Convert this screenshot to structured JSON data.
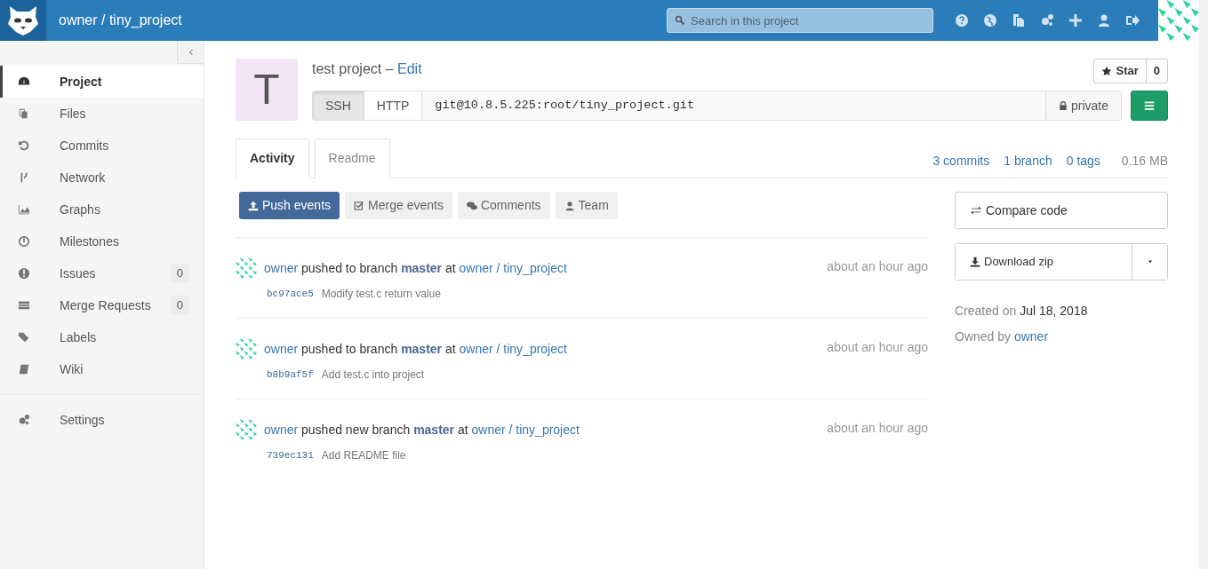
{
  "header": {
    "title": "owner / tiny_project",
    "search": {
      "placeholder": "Search in this project"
    }
  },
  "sidebar": {
    "items": [
      {
        "label": "Project",
        "selected": true
      },
      {
        "label": "Files",
        "selected": false
      },
      {
        "label": "Commits",
        "selected": false
      },
      {
        "label": "Network",
        "selected": false
      },
      {
        "label": "Graphs",
        "selected": false
      },
      {
        "label": "Milestones",
        "selected": false
      },
      {
        "label": "Issues",
        "selected": false,
        "count": "0"
      },
      {
        "label": "Merge Requests",
        "selected": false,
        "count": "0"
      },
      {
        "label": "Labels",
        "selected": false
      },
      {
        "label": "Wiki",
        "selected": false
      }
    ],
    "footer_items": [
      {
        "label": "Settings",
        "selected": false
      }
    ]
  },
  "project": {
    "avatar_letter": "T",
    "name": "test project –",
    "edit_link": "Edit",
    "star": {
      "label": "Star",
      "count": "0"
    },
    "clone": {
      "protocols": [
        {
          "label": "SSH",
          "selected": true
        },
        {
          "label": "HTTP",
          "selected": false
        }
      ],
      "url": "git@10.8.5.225:root/tiny_project.git",
      "visibility": "private"
    }
  },
  "tabs": [
    {
      "label": "Activity",
      "selected": true
    },
    {
      "label": "Readme",
      "selected": false
    }
  ],
  "stats": [
    {
      "label": "3 commits",
      "kind": "link"
    },
    {
      "label": "1 branch",
      "kind": "link"
    },
    {
      "label": "0 tags",
      "kind": "link"
    },
    {
      "label": "0.16 MB",
      "kind": "text"
    }
  ],
  "filters": [
    {
      "label": "Push events",
      "selected": true
    },
    {
      "label": "Merge events",
      "selected": false
    },
    {
      "label": "Comments",
      "selected": false
    },
    {
      "label": "Team",
      "selected": false
    }
  ],
  "events": [
    {
      "user": "owner",
      "action": "pushed to branch",
      "branch": "master",
      "at": "at",
      "project": "owner / tiny_project",
      "time": "about an hour ago",
      "sha": "bc97ace5",
      "message": "Modify test.c return value"
    },
    {
      "user": "owner",
      "action": "pushed to branch",
      "branch": "master",
      "at": "at",
      "project": "owner / tiny_project",
      "time": "about an hour ago",
      "sha": "b8b9af5f",
      "message": "Add test.c into project"
    },
    {
      "user": "owner",
      "action": "pushed new branch",
      "branch": "master",
      "at": "at",
      "project": "owner / tiny_project",
      "time": "about an hour ago",
      "sha": "739ec131",
      "message": "Add README file"
    }
  ],
  "aside": {
    "compare": "Compare code",
    "download": "Download zip",
    "created_label": "Created on",
    "created_date": "Jul 18, 2018",
    "owned_label": "Owned by",
    "owner": "owner"
  }
}
